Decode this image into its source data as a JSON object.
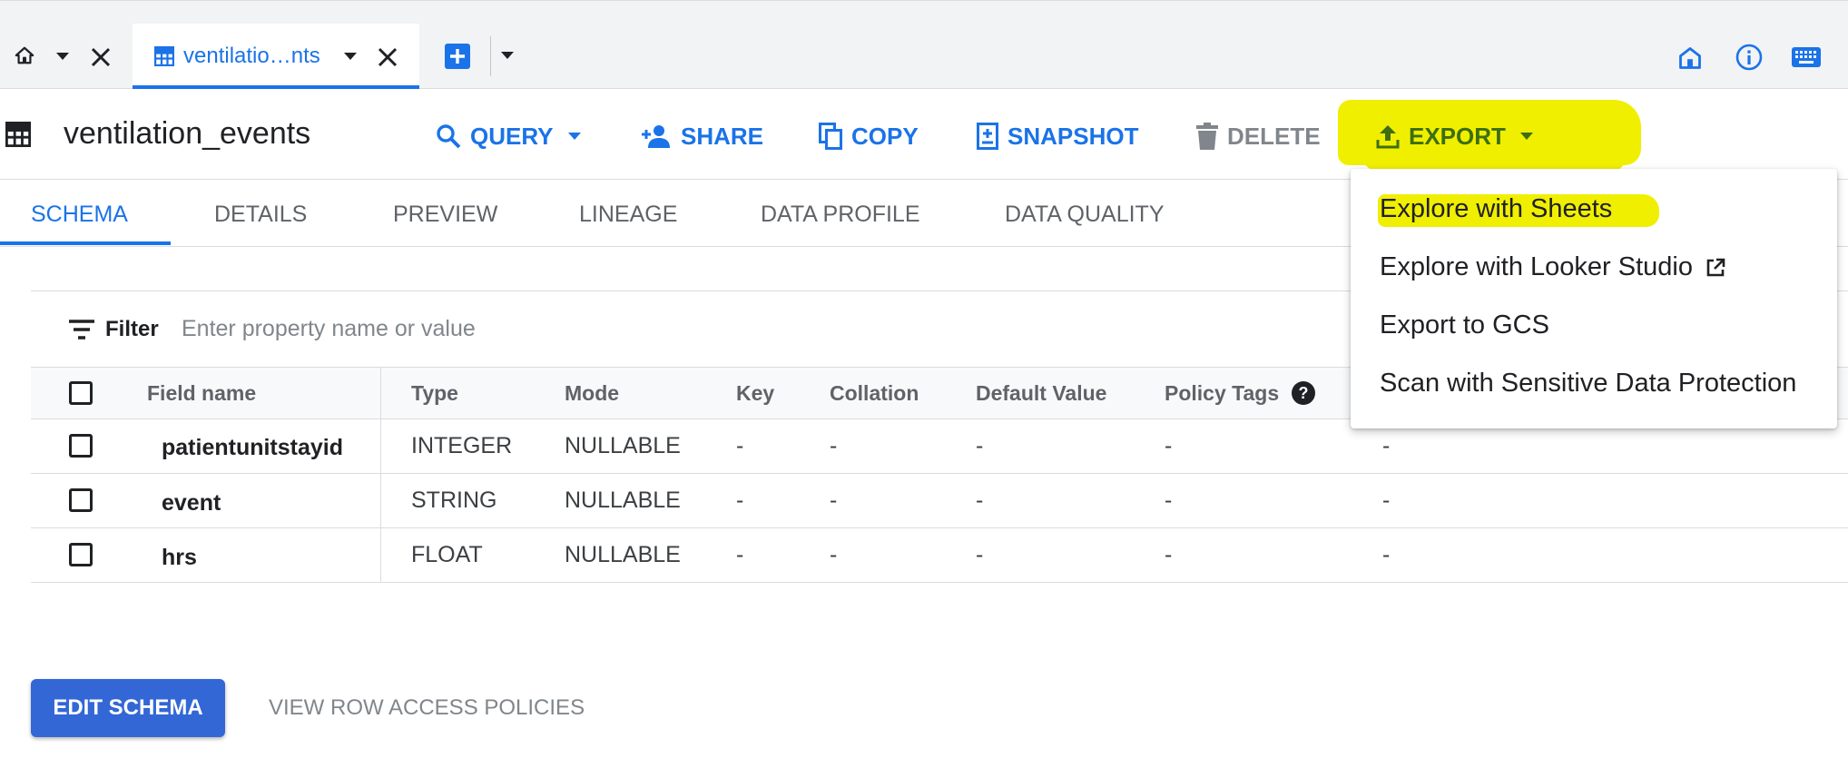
{
  "tabs": {
    "active_tab_label": "ventilatio…nts"
  },
  "toolbar": {
    "title": "ventilation_events",
    "buttons": {
      "query": "QUERY",
      "share": "SHARE",
      "copy": "COPY",
      "snapshot": "SNAPSHOT",
      "delete": "DELETE",
      "export": "EXPORT"
    }
  },
  "subtabs": {
    "schema": "SCHEMA",
    "details": "DETAILS",
    "preview": "PREVIEW",
    "lineage": "LINEAGE",
    "data_profile": "DATA PROFILE",
    "data_quality": "DATA QUALITY"
  },
  "filter": {
    "label": "Filter",
    "placeholder": "Enter property name or value"
  },
  "table": {
    "headers": {
      "field_name": "Field name",
      "type": "Type",
      "mode": "Mode",
      "key": "Key",
      "collation": "Collation",
      "default_value": "Default Value",
      "policy_tags": "Policy Tags"
    },
    "rows": [
      {
        "field": "patientunitstayid",
        "type": "INTEGER",
        "mode": "NULLABLE",
        "key": "-",
        "collation": "-",
        "default_value": "-",
        "policy_tags": "-",
        "extra": "-"
      },
      {
        "field": "event",
        "type": "STRING",
        "mode": "NULLABLE",
        "key": "-",
        "collation": "-",
        "default_value": "-",
        "policy_tags": "-",
        "extra": "-"
      },
      {
        "field": "hrs",
        "type": "FLOAT",
        "mode": "NULLABLE",
        "key": "-",
        "collation": "-",
        "default_value": "-",
        "policy_tags": "-",
        "extra": "-"
      }
    ]
  },
  "actions": {
    "edit_schema": "EDIT SCHEMA",
    "view_row_access_policies": "VIEW ROW ACCESS POLICIES"
  },
  "export_menu": {
    "items": [
      "Explore with Sheets",
      "Explore with Looker Studio",
      "Export to GCS",
      "Scan with Sensitive Data Protection"
    ]
  },
  "colors": {
    "accent": "#1a73e8",
    "button_primary": "#3367d6",
    "highlight": "#f0ef00",
    "muted": "#5f6368"
  }
}
